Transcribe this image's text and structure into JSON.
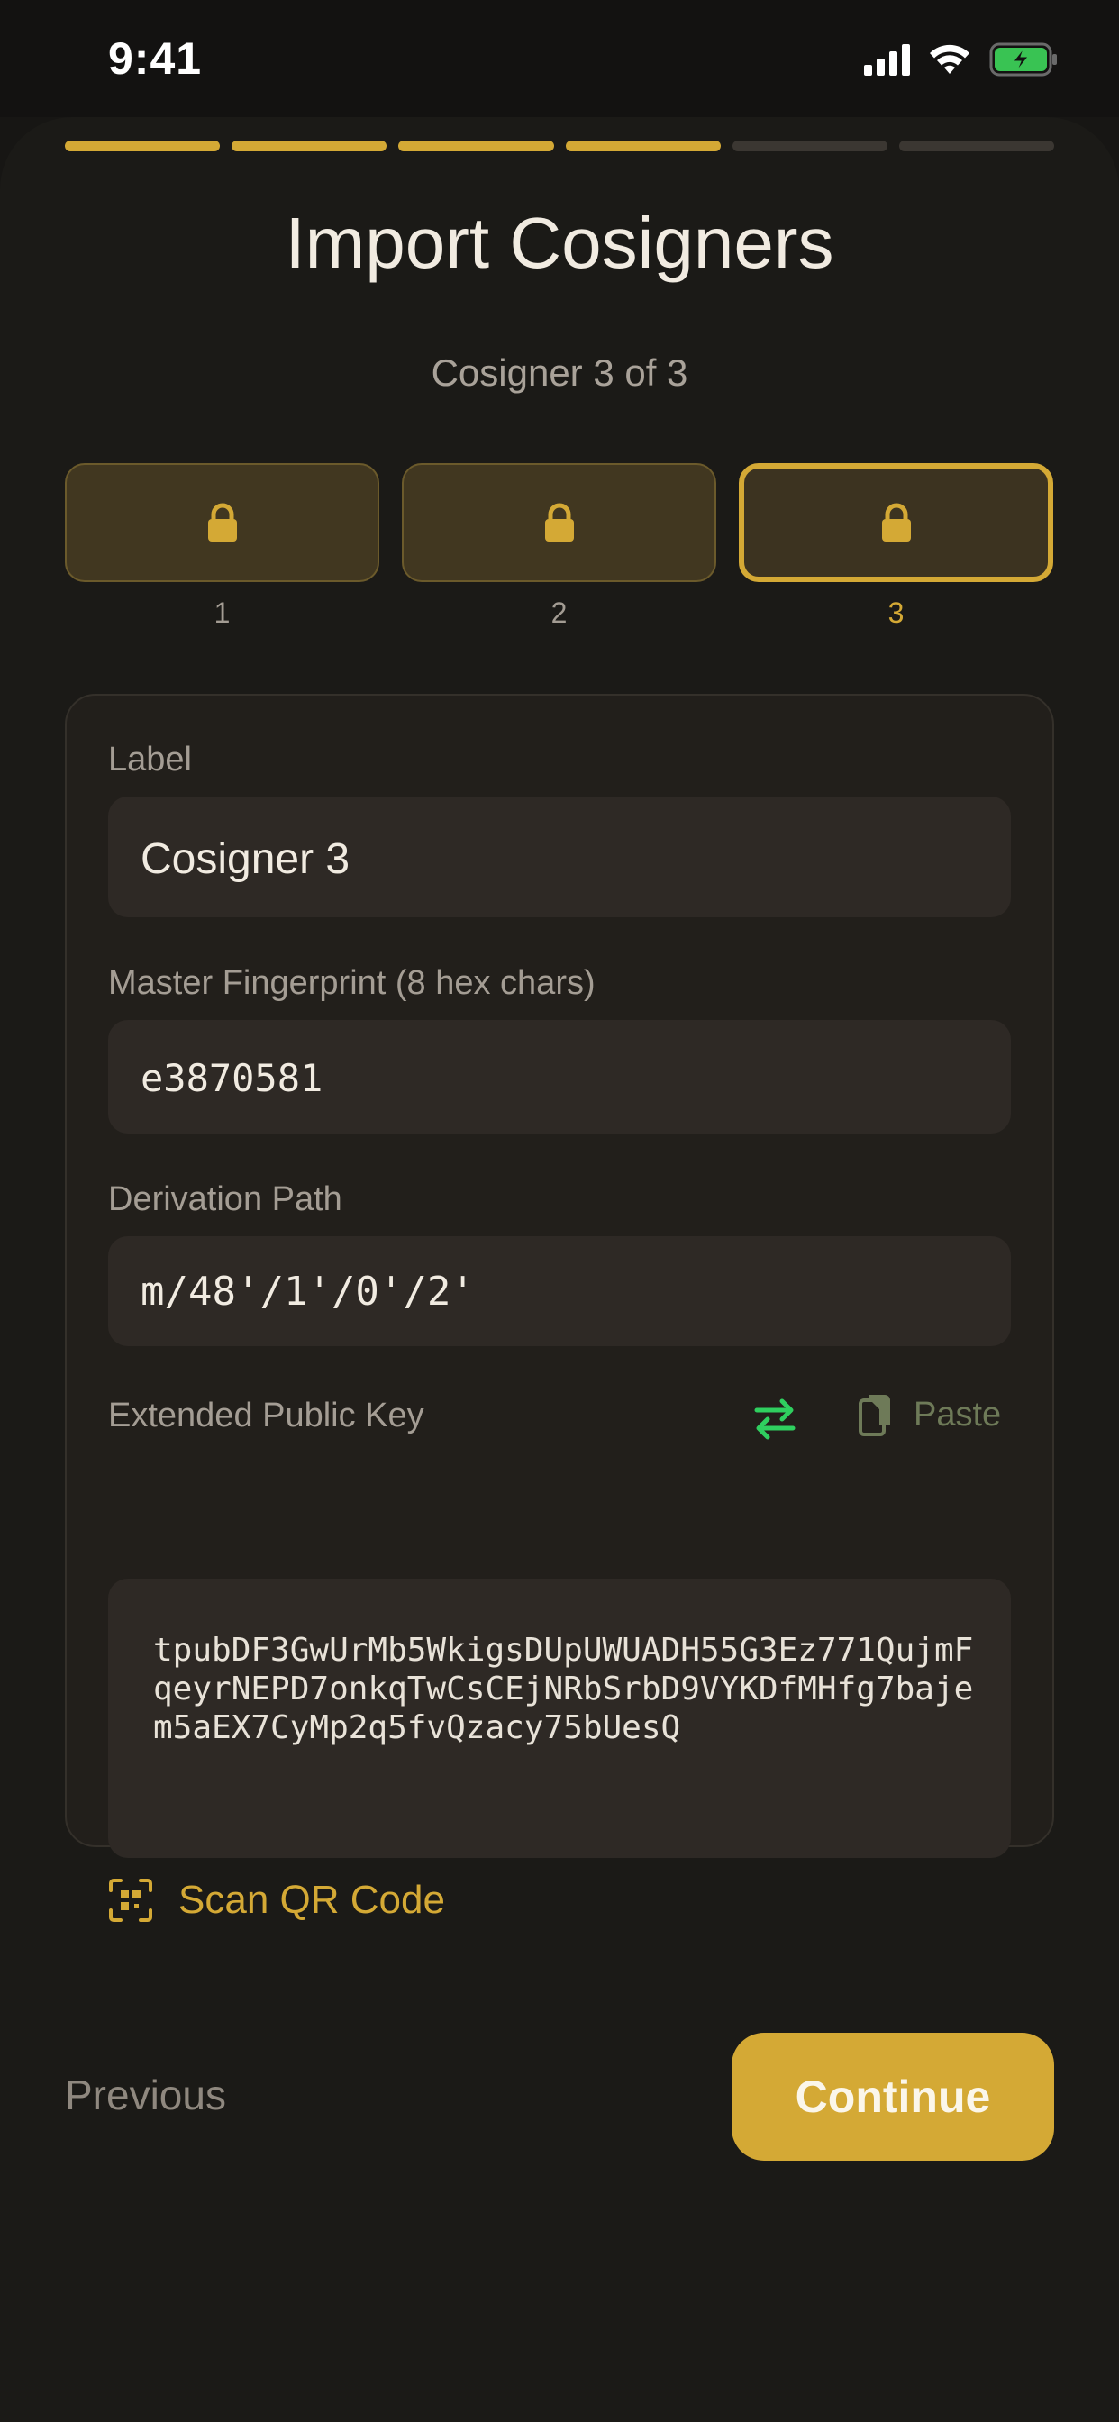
{
  "status_bar": {
    "time": "9:41"
  },
  "progress": {
    "total_steps": 6,
    "completed_steps": 4
  },
  "header": {
    "title": "Import Cosigners",
    "subtitle": "Cosigner 3 of 3"
  },
  "cosigners": [
    {
      "label": "1",
      "icon": "lock-icon",
      "active": false
    },
    {
      "label": "2",
      "icon": "lock-icon",
      "active": false
    },
    {
      "label": "3",
      "icon": "lock-icon",
      "active": true
    }
  ],
  "form": {
    "label_field": {
      "label": "Label",
      "value": "Cosigner 3"
    },
    "fingerprint_field": {
      "label": "Master Fingerprint (8 hex chars)",
      "value": "e3870581"
    },
    "derivation_field": {
      "label": "Derivation Path",
      "value": "m/48'/1'/0'/2'"
    },
    "xpub_field": {
      "label": "Extended Public Key",
      "value": "tpubDF3GwUrMb5WkigsDUpUWUADH55G3Ez771QujmFqeyrNEPD7onkqTwCsCEjNRbSrbD9VYKDfMHfg7bajem5aEX7CyMp2q5fvQzacy75bUesQ",
      "paste_label": "Paste"
    },
    "scan_label": "Scan QR Code"
  },
  "footer": {
    "previous_label": "Previous",
    "continue_label": "Continue"
  },
  "colors": {
    "accent": "#d4a935",
    "background": "#171614",
    "card": "#221f1b",
    "field": "#2e2925",
    "swap_green": "#2fcf5f",
    "paste_muted": "#6e7a58"
  }
}
